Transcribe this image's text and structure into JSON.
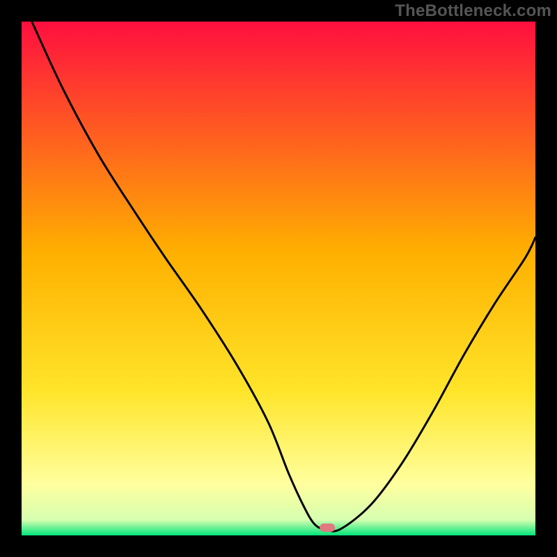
{
  "watermark": "TheBottleneck.com",
  "chart_data": {
    "type": "line",
    "title": "",
    "xlabel": "",
    "ylabel": "",
    "xlim": [
      0,
      100
    ],
    "ylim": [
      0,
      100
    ],
    "legend": false,
    "grid": false,
    "background_gradient_top": "#ff0f3f",
    "background_gradient_mid": "#ffd500",
    "background_gradient_mid2": "#ffff8c",
    "background_gradient_bottom": "#00e57a",
    "axis_color": "#000000",
    "line_color": "#000000",
    "marker": {
      "x": 59.5,
      "y": 1.5,
      "color": "#e07a80",
      "shape": "rounded-rect"
    },
    "x": [
      2,
      8,
      15,
      22,
      28,
      35,
      42,
      48,
      52,
      55,
      57,
      59,
      62,
      68,
      74,
      80,
      86,
      92,
      98,
      100
    ],
    "y": [
      100,
      87,
      74,
      63,
      54,
      44,
      33,
      22,
      12,
      5.5,
      2.2,
      1.2,
      1.2,
      6,
      14,
      24,
      35,
      45,
      54,
      58
    ]
  }
}
